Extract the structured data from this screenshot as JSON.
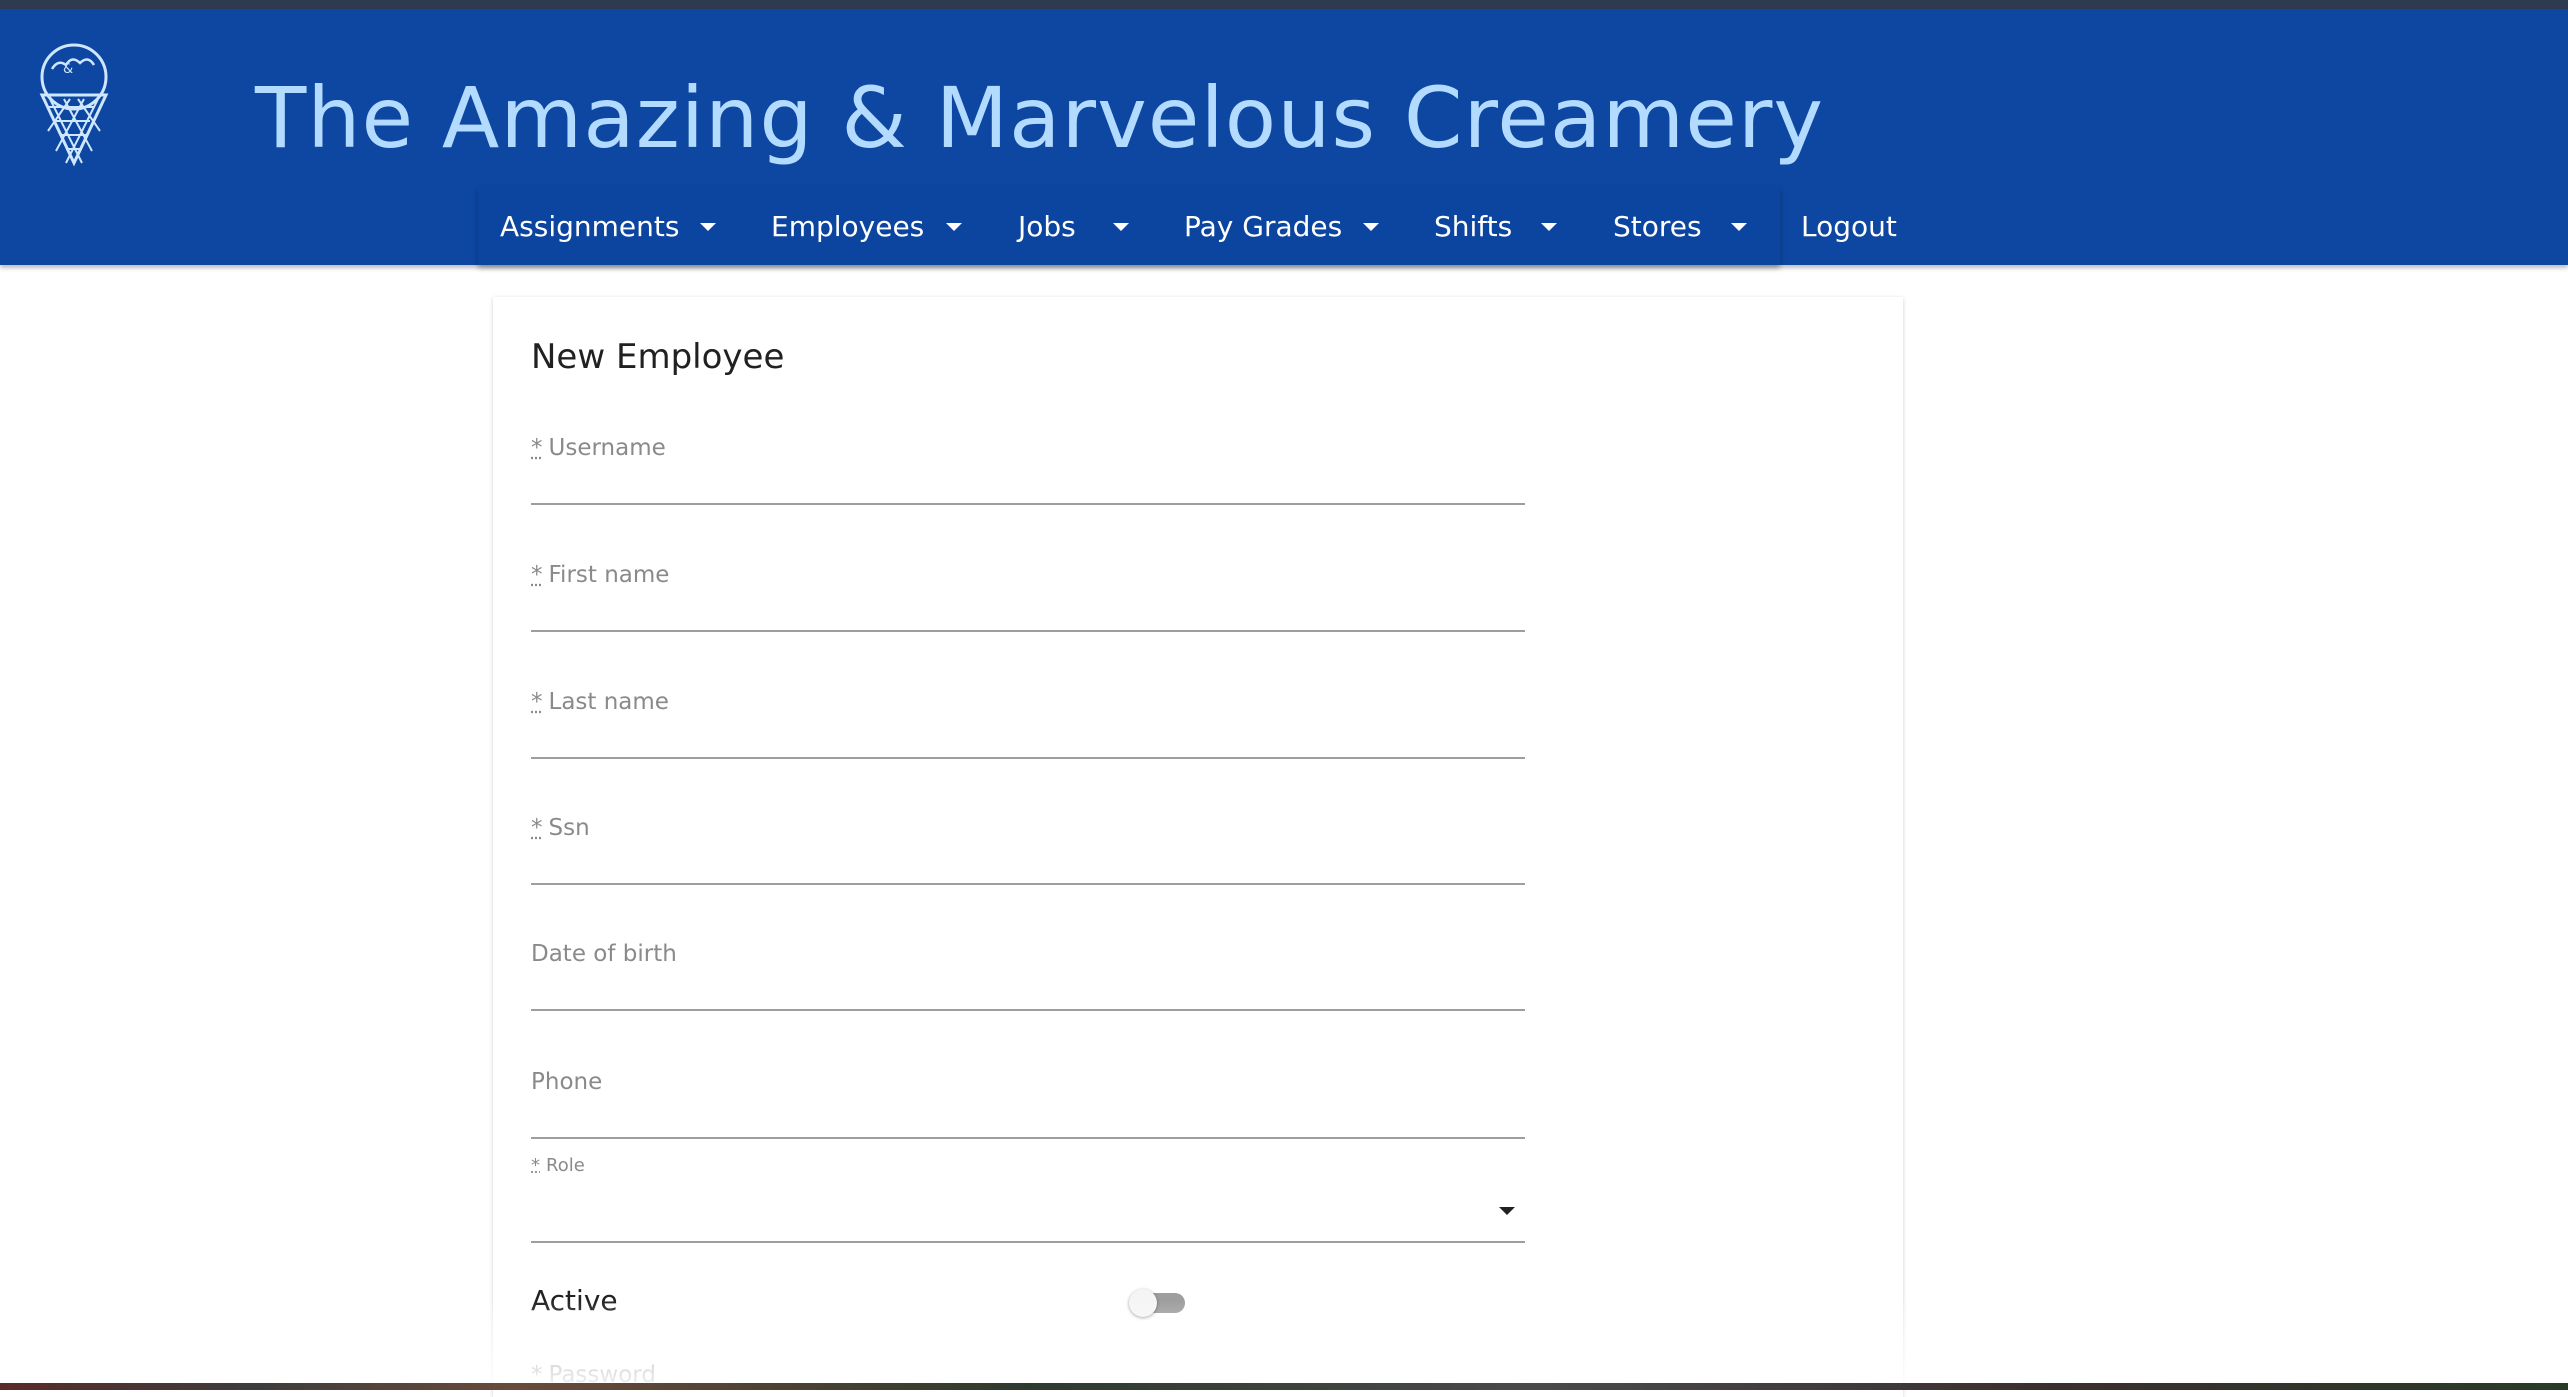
{
  "app": {
    "title": "The Amazing & Marvelous Creamery",
    "logo_icon": "ice-cream-cone-icon"
  },
  "colors": {
    "header_bg": "#0d47a1",
    "title_text": "#b3dbff",
    "nav_text": "#ffffff"
  },
  "nav": {
    "items": [
      {
        "label": "Assignments",
        "has_dropdown": true
      },
      {
        "label": "Employees",
        "has_dropdown": true
      },
      {
        "label": "Jobs",
        "has_dropdown": true
      },
      {
        "label": "Pay Grades",
        "has_dropdown": true
      },
      {
        "label": "Shifts",
        "has_dropdown": true
      },
      {
        "label": "Stores",
        "has_dropdown": true
      },
      {
        "label": "Logout",
        "has_dropdown": false
      }
    ]
  },
  "form": {
    "title": "New Employee",
    "required_marker": "*",
    "fields": {
      "username": {
        "label": "Username",
        "required": true,
        "value": ""
      },
      "first_name": {
        "label": "First name",
        "required": true,
        "value": ""
      },
      "last_name": {
        "label": "Last name",
        "required": true,
        "value": ""
      },
      "ssn": {
        "label": "Ssn",
        "required": true,
        "value": ""
      },
      "date_of_birth": {
        "label": "Date of birth",
        "required": false,
        "value": ""
      },
      "phone": {
        "label": "Phone",
        "required": false,
        "value": ""
      },
      "role": {
        "label": "Role",
        "required": true,
        "value": ""
      },
      "password": {
        "label": "Password",
        "required": true,
        "value": ""
      }
    },
    "active": {
      "label": "Active",
      "checked": false
    }
  }
}
